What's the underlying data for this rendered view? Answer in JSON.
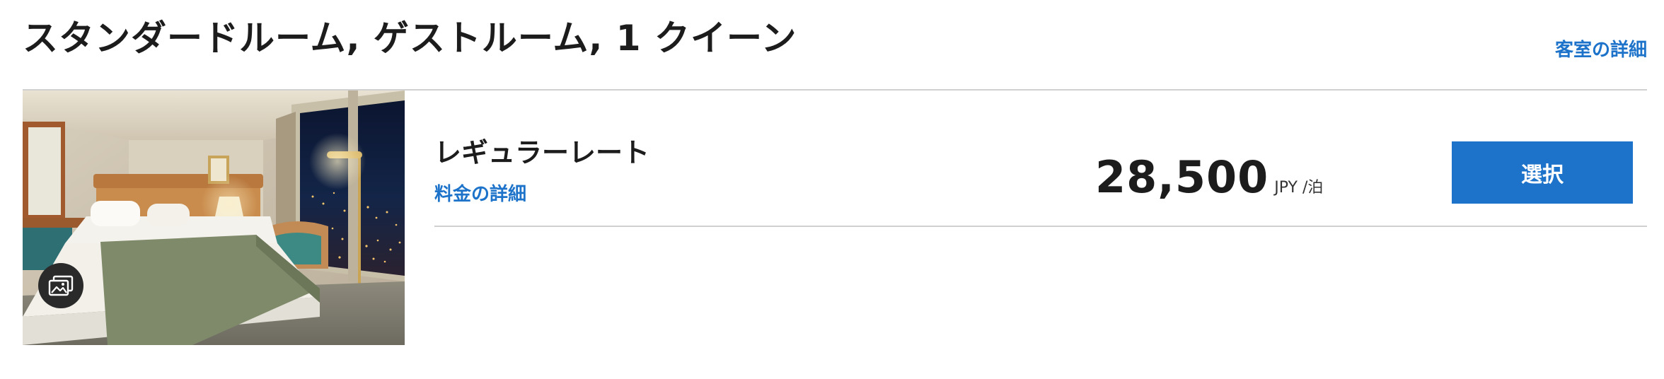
{
  "room": {
    "title": "スタンダードルーム, ゲストルーム, 1 クイーン",
    "details_link": "客室の詳細"
  },
  "photo": {
    "alt": "",
    "gallery_icon": "image-gallery-icon"
  },
  "rate": {
    "name": "レギュラーレート",
    "details_link": "料金の詳細",
    "price": "28,500",
    "unit": "JPY /泊",
    "select_label": "選択"
  },
  "colors": {
    "accent": "#1c73c9",
    "text": "#1c1c1c",
    "divider": "#d0d0d0"
  }
}
